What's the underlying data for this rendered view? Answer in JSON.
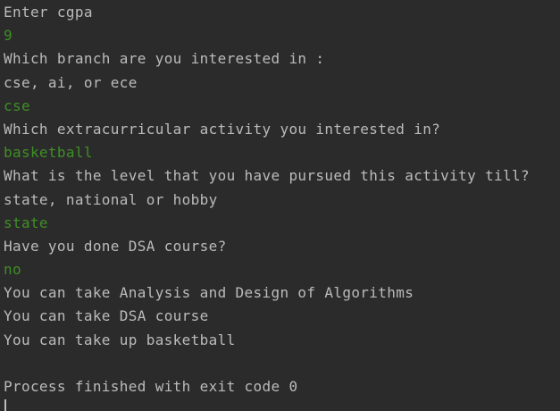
{
  "console": {
    "lines": [
      {
        "text": "Enter cgpa",
        "kind": "output"
      },
      {
        "text": "9",
        "kind": "input"
      },
      {
        "text": "Which branch are you interested in :",
        "kind": "output"
      },
      {
        "text": "cse, ai, or ece",
        "kind": "output"
      },
      {
        "text": "cse",
        "kind": "input"
      },
      {
        "text": "Which extracurricular activity you interested in?",
        "kind": "output"
      },
      {
        "text": "basketball",
        "kind": "input"
      },
      {
        "text": "What is the level that you have pursued this activity till?",
        "kind": "output"
      },
      {
        "text": "state, national or hobby",
        "kind": "output"
      },
      {
        "text": "state",
        "kind": "input"
      },
      {
        "text": "Have you done DSA course?",
        "kind": "output"
      },
      {
        "text": "no",
        "kind": "input"
      },
      {
        "text": "You can take Analysis and Design of Algorithms",
        "kind": "output"
      },
      {
        "text": "You can take DSA course",
        "kind": "output"
      },
      {
        "text": "You can take up basketball",
        "kind": "output"
      },
      {
        "text": "",
        "kind": "blank"
      },
      {
        "text": "Process finished with exit code 0",
        "kind": "output"
      }
    ]
  },
  "colors": {
    "background": "#2b2b2b",
    "output_text": "#bbbbbb",
    "input_text": "#3f8f25"
  }
}
